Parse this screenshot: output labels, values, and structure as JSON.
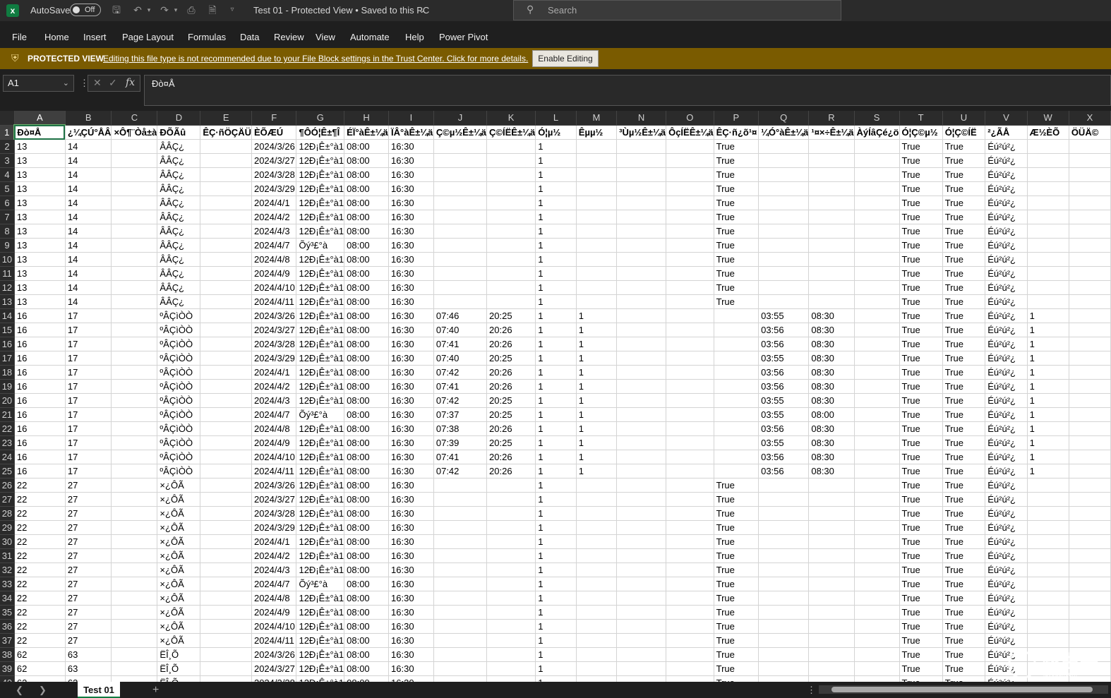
{
  "titlebar": {
    "autosave_label": "AutoSave",
    "autosave_state": "Off",
    "doc_title": "Test 01  -  Protected View  •  Saved to this PC",
    "search_placeholder": "Search"
  },
  "menu": [
    "File",
    "Home",
    "Insert",
    "Page Layout",
    "Formulas",
    "Data",
    "Review",
    "View",
    "Automate",
    "Help",
    "Power Pivot"
  ],
  "protected_view": {
    "title": "PROTECTED VIEW",
    "message": "Editing this file type is not recommended due to your File Block settings in the Trust Center. Click for more details.",
    "button": "Enable Editing"
  },
  "formula_bar": {
    "name_box": "A1",
    "fx": "fx",
    "value": "Ðò¤Å"
  },
  "sheet": {
    "columns": [
      "A",
      "B",
      "C",
      "D",
      "E",
      "F",
      "G",
      "H",
      "I",
      "J",
      "K",
      "L",
      "M",
      "N",
      "O",
      "P",
      "Q",
      "R",
      "S",
      "T",
      "U",
      "V",
      "W",
      "X"
    ],
    "header_row": [
      "Ðò¤Å",
      "¿¼ÇÚ°ÅÂ",
      "×Ô¶¨Òå±à",
      "ÐÕÃû",
      "ÊÇ·ñÖÇÄÜ",
      "ÈÕÆÚ",
      "¶ÔÓ¦Ê±¶Î",
      "ÉÏ°àÊ±¼ä",
      "ÏÂ°àÊ±¼ä",
      "Ç©µ½Ê±¼ä",
      "Ç©ÍËÊ±¼ä",
      "Ó¦µ½",
      "Êµµ½",
      "³Ùµ½Ê±¼ä",
      "ÔçÍËÊ±¼ä",
      "ÊÇ·ñ¿õ¹¤",
      "¼Ó°àÊ±¼ä",
      "¹¤×÷Ê±¼ä",
      "ÀýÍâÇé¿ö",
      "Ó¦Ç©µ½",
      "Ó¦Ç©ÍË",
      "²¿ÃÅ",
      "Æ½ÈÕ",
      "ÖÜÄ©"
    ],
    "rows": [
      [
        "13",
        "14",
        "",
        "ÂÂÇ¿",
        "",
        "2024/3/26",
        "12Ð¡Ê±°à1",
        "08:00",
        "16:30",
        "",
        "",
        "1",
        "",
        "",
        "",
        "True",
        "",
        "",
        "",
        "True",
        "True",
        "Éú²ú²¿",
        "",
        ""
      ],
      [
        "13",
        "14",
        "",
        "ÂÂÇ¿",
        "",
        "2024/3/27",
        "12Ð¡Ê±°à1",
        "08:00",
        "16:30",
        "",
        "",
        "1",
        "",
        "",
        "",
        "True",
        "",
        "",
        "",
        "True",
        "True",
        "Éú²ú²¿",
        "",
        ""
      ],
      [
        "13",
        "14",
        "",
        "ÂÂÇ¿",
        "",
        "2024/3/28",
        "12Ð¡Ê±°à1",
        "08:00",
        "16:30",
        "",
        "",
        "1",
        "",
        "",
        "",
        "True",
        "",
        "",
        "",
        "True",
        "True",
        "Éú²ú²¿",
        "",
        ""
      ],
      [
        "13",
        "14",
        "",
        "ÂÂÇ¿",
        "",
        "2024/3/29",
        "12Ð¡Ê±°à1",
        "08:00",
        "16:30",
        "",
        "",
        "1",
        "",
        "",
        "",
        "True",
        "",
        "",
        "",
        "True",
        "True",
        "Éú²ú²¿",
        "",
        ""
      ],
      [
        "13",
        "14",
        "",
        "ÂÂÇ¿",
        "",
        "2024/4/1",
        "12Ð¡Ê±°à1",
        "08:00",
        "16:30",
        "",
        "",
        "1",
        "",
        "",
        "",
        "True",
        "",
        "",
        "",
        "True",
        "True",
        "Éú²ú²¿",
        "",
        ""
      ],
      [
        "13",
        "14",
        "",
        "ÂÂÇ¿",
        "",
        "2024/4/2",
        "12Ð¡Ê±°à1",
        "08:00",
        "16:30",
        "",
        "",
        "1",
        "",
        "",
        "",
        "True",
        "",
        "",
        "",
        "True",
        "True",
        "Éú²ú²¿",
        "",
        ""
      ],
      [
        "13",
        "14",
        "",
        "ÂÂÇ¿",
        "",
        "2024/4/3",
        "12Ð¡Ê±°à1",
        "08:00",
        "16:30",
        "",
        "",
        "1",
        "",
        "",
        "",
        "True",
        "",
        "",
        "",
        "True",
        "True",
        "Éú²ú²¿",
        "",
        ""
      ],
      [
        "13",
        "14",
        "",
        "ÂÂÇ¿",
        "",
        "2024/4/7",
        "Õý³£°à",
        "08:00",
        "16:30",
        "",
        "",
        "1",
        "",
        "",
        "",
        "True",
        "",
        "",
        "",
        "True",
        "True",
        "Éú²ú²¿",
        "",
        ""
      ],
      [
        "13",
        "14",
        "",
        "ÂÂÇ¿",
        "",
        "2024/4/8",
        "12Ð¡Ê±°à1",
        "08:00",
        "16:30",
        "",
        "",
        "1",
        "",
        "",
        "",
        "True",
        "",
        "",
        "",
        "True",
        "True",
        "Éú²ú²¿",
        "",
        ""
      ],
      [
        "13",
        "14",
        "",
        "ÂÂÇ¿",
        "",
        "2024/4/9",
        "12Ð¡Ê±°à1",
        "08:00",
        "16:30",
        "",
        "",
        "1",
        "",
        "",
        "",
        "True",
        "",
        "",
        "",
        "True",
        "True",
        "Éú²ú²¿",
        "",
        ""
      ],
      [
        "13",
        "14",
        "",
        "ÂÂÇ¿",
        "",
        "2024/4/10",
        "12Ð¡Ê±°à1",
        "08:00",
        "16:30",
        "",
        "",
        "1",
        "",
        "",
        "",
        "True",
        "",
        "",
        "",
        "True",
        "True",
        "Éú²ú²¿",
        "",
        ""
      ],
      [
        "13",
        "14",
        "",
        "ÂÂÇ¿",
        "",
        "2024/4/11",
        "12Ð¡Ê±°à1",
        "08:00",
        "16:30",
        "",
        "",
        "1",
        "",
        "",
        "",
        "True",
        "",
        "",
        "",
        "True",
        "True",
        "Éú²ú²¿",
        "",
        ""
      ],
      [
        "16",
        "17",
        "",
        "ºÂÇìÒÒ",
        "",
        "2024/3/26",
        "12Ð¡Ê±°à1",
        "08:00",
        "16:30",
        "07:46",
        "20:25",
        "1",
        "1",
        "",
        "",
        "",
        "03:55",
        "08:30",
        "",
        "True",
        "True",
        "Éú²ú²¿",
        "1",
        ""
      ],
      [
        "16",
        "17",
        "",
        "ºÂÇìÒÒ",
        "",
        "2024/3/27",
        "12Ð¡Ê±°à1",
        "08:00",
        "16:30",
        "07:40",
        "20:26",
        "1",
        "1",
        "",
        "",
        "",
        "03:56",
        "08:30",
        "",
        "True",
        "True",
        "Éú²ú²¿",
        "1",
        ""
      ],
      [
        "16",
        "17",
        "",
        "ºÂÇìÒÒ",
        "",
        "2024/3/28",
        "12Ð¡Ê±°à1",
        "08:00",
        "16:30",
        "07:41",
        "20:26",
        "1",
        "1",
        "",
        "",
        "",
        "03:56",
        "08:30",
        "",
        "True",
        "True",
        "Éú²ú²¿",
        "1",
        ""
      ],
      [
        "16",
        "17",
        "",
        "ºÂÇìÒÒ",
        "",
        "2024/3/29",
        "12Ð¡Ê±°à1",
        "08:00",
        "16:30",
        "07:40",
        "20:25",
        "1",
        "1",
        "",
        "",
        "",
        "03:55",
        "08:30",
        "",
        "True",
        "True",
        "Éú²ú²¿",
        "1",
        ""
      ],
      [
        "16",
        "17",
        "",
        "ºÂÇìÒÒ",
        "",
        "2024/4/1",
        "12Ð¡Ê±°à1",
        "08:00",
        "16:30",
        "07:42",
        "20:26",
        "1",
        "1",
        "",
        "",
        "",
        "03:56",
        "08:30",
        "",
        "True",
        "True",
        "Éú²ú²¿",
        "1",
        ""
      ],
      [
        "16",
        "17",
        "",
        "ºÂÇìÒÒ",
        "",
        "2024/4/2",
        "12Ð¡Ê±°à1",
        "08:00",
        "16:30",
        "07:41",
        "20:26",
        "1",
        "1",
        "",
        "",
        "",
        "03:56",
        "08:30",
        "",
        "True",
        "True",
        "Éú²ú²¿",
        "1",
        ""
      ],
      [
        "16",
        "17",
        "",
        "ºÂÇìÒÒ",
        "",
        "2024/4/3",
        "12Ð¡Ê±°à1",
        "08:00",
        "16:30",
        "07:42",
        "20:25",
        "1",
        "1",
        "",
        "",
        "",
        "03:55",
        "08:30",
        "",
        "True",
        "True",
        "Éú²ú²¿",
        "1",
        ""
      ],
      [
        "16",
        "17",
        "",
        "ºÂÇìÒÒ",
        "",
        "2024/4/7",
        "Õý³£°à",
        "08:00",
        "16:30",
        "07:37",
        "20:25",
        "1",
        "1",
        "",
        "",
        "",
        "03:55",
        "08:00",
        "",
        "True",
        "True",
        "Éú²ú²¿",
        "1",
        ""
      ],
      [
        "16",
        "17",
        "",
        "ºÂÇìÒÒ",
        "",
        "2024/4/8",
        "12Ð¡Ê±°à1",
        "08:00",
        "16:30",
        "07:38",
        "20:26",
        "1",
        "1",
        "",
        "",
        "",
        "03:56",
        "08:30",
        "",
        "True",
        "True",
        "Éú²ú²¿",
        "1",
        ""
      ],
      [
        "16",
        "17",
        "",
        "ºÂÇìÒÒ",
        "",
        "2024/4/9",
        "12Ð¡Ê±°à1",
        "08:00",
        "16:30",
        "07:39",
        "20:25",
        "1",
        "1",
        "",
        "",
        "",
        "03:55",
        "08:30",
        "",
        "True",
        "True",
        "Éú²ú²¿",
        "1",
        ""
      ],
      [
        "16",
        "17",
        "",
        "ºÂÇìÒÒ",
        "",
        "2024/4/10",
        "12Ð¡Ê±°à1",
        "08:00",
        "16:30",
        "07:41",
        "20:26",
        "1",
        "1",
        "",
        "",
        "",
        "03:56",
        "08:30",
        "",
        "True",
        "True",
        "Éú²ú²¿",
        "1",
        ""
      ],
      [
        "16",
        "17",
        "",
        "ºÂÇìÒÒ",
        "",
        "2024/4/11",
        "12Ð¡Ê±°à1",
        "08:00",
        "16:30",
        "07:42",
        "20:26",
        "1",
        "1",
        "",
        "",
        "",
        "03:56",
        "08:30",
        "",
        "True",
        "True",
        "Éú²ú²¿",
        "1",
        ""
      ],
      [
        "22",
        "27",
        "",
        "×¿ÔÃ",
        "",
        "2024/3/26",
        "12Ð¡Ê±°à1",
        "08:00",
        "16:30",
        "",
        "",
        "1",
        "",
        "",
        "",
        "True",
        "",
        "",
        "",
        "True",
        "True",
        "Éú²ú²¿",
        "",
        ""
      ],
      [
        "22",
        "27",
        "",
        "×¿ÔÃ",
        "",
        "2024/3/27",
        "12Ð¡Ê±°à1",
        "08:00",
        "16:30",
        "",
        "",
        "1",
        "",
        "",
        "",
        "True",
        "",
        "",
        "",
        "True",
        "True",
        "Éú²ú²¿",
        "",
        ""
      ],
      [
        "22",
        "27",
        "",
        "×¿ÔÃ",
        "",
        "2024/3/28",
        "12Ð¡Ê±°à1",
        "08:00",
        "16:30",
        "",
        "",
        "1",
        "",
        "",
        "",
        "True",
        "",
        "",
        "",
        "True",
        "True",
        "Éú²ú²¿",
        "",
        ""
      ],
      [
        "22",
        "27",
        "",
        "×¿ÔÃ",
        "",
        "2024/3/29",
        "12Ð¡Ê±°à1",
        "08:00",
        "16:30",
        "",
        "",
        "1",
        "",
        "",
        "",
        "True",
        "",
        "",
        "",
        "True",
        "True",
        "Éú²ú²¿",
        "",
        ""
      ],
      [
        "22",
        "27",
        "",
        "×¿ÔÃ",
        "",
        "2024/4/1",
        "12Ð¡Ê±°à1",
        "08:00",
        "16:30",
        "",
        "",
        "1",
        "",
        "",
        "",
        "True",
        "",
        "",
        "",
        "True",
        "True",
        "Éú²ú²¿",
        "",
        ""
      ],
      [
        "22",
        "27",
        "",
        "×¿ÔÃ",
        "",
        "2024/4/2",
        "12Ð¡Ê±°à1",
        "08:00",
        "16:30",
        "",
        "",
        "1",
        "",
        "",
        "",
        "True",
        "",
        "",
        "",
        "True",
        "True",
        "Éú²ú²¿",
        "",
        ""
      ],
      [
        "22",
        "27",
        "",
        "×¿ÔÃ",
        "",
        "2024/4/3",
        "12Ð¡Ê±°à1",
        "08:00",
        "16:30",
        "",
        "",
        "1",
        "",
        "",
        "",
        "True",
        "",
        "",
        "",
        "True",
        "True",
        "Éú²ú²¿",
        "",
        ""
      ],
      [
        "22",
        "27",
        "",
        "×¿ÔÃ",
        "",
        "2024/4/7",
        "Õý³£°à",
        "08:00",
        "16:30",
        "",
        "",
        "1",
        "",
        "",
        "",
        "True",
        "",
        "",
        "",
        "True",
        "True",
        "Éú²ú²¿",
        "",
        ""
      ],
      [
        "22",
        "27",
        "",
        "×¿ÔÃ",
        "",
        "2024/4/8",
        "12Ð¡Ê±°à1",
        "08:00",
        "16:30",
        "",
        "",
        "1",
        "",
        "",
        "",
        "True",
        "",
        "",
        "",
        "True",
        "True",
        "Éú²ú²¿",
        "",
        ""
      ],
      [
        "22",
        "27",
        "",
        "×¿ÔÃ",
        "",
        "2024/4/9",
        "12Ð¡Ê±°à1",
        "08:00",
        "16:30",
        "",
        "",
        "1",
        "",
        "",
        "",
        "True",
        "",
        "",
        "",
        "True",
        "True",
        "Éú²ú²¿",
        "",
        ""
      ],
      [
        "22",
        "27",
        "",
        "×¿ÔÃ",
        "",
        "2024/4/10",
        "12Ð¡Ê±°à1",
        "08:00",
        "16:30",
        "",
        "",
        "1",
        "",
        "",
        "",
        "True",
        "",
        "",
        "",
        "True",
        "True",
        "Éú²ú²¿",
        "",
        ""
      ],
      [
        "22",
        "27",
        "",
        "×¿ÔÃ",
        "",
        "2024/4/11",
        "12Ð¡Ê±°à1",
        "08:00",
        "16:30",
        "",
        "",
        "1",
        "",
        "",
        "",
        "True",
        "",
        "",
        "",
        "True",
        "True",
        "Éú²ú²¿",
        "",
        ""
      ],
      [
        "62",
        "63",
        "",
        "ËÎ¸Õ",
        "",
        "2024/3/26",
        "12Ð¡Ê±°à1",
        "08:00",
        "16:30",
        "",
        "",
        "1",
        "",
        "",
        "",
        "True",
        "",
        "",
        "",
        "True",
        "True",
        "Éú²ú²¿",
        "",
        ""
      ],
      [
        "62",
        "63",
        "",
        "ËÎ¸Õ",
        "",
        "2024/3/27",
        "12Ð¡Ê±°à1",
        "08:00",
        "16:30",
        "",
        "",
        "1",
        "",
        "",
        "",
        "True",
        "",
        "",
        "",
        "True",
        "True",
        "Éú²ú²¿",
        "",
        ""
      ],
      [
        "62",
        "63",
        "",
        "ËÎ¸Õ",
        "",
        "2024/3/28",
        "12Ð¡Ê±°à1",
        "08:00",
        "16:30",
        "",
        "",
        "1",
        "",
        "",
        "",
        "True",
        "",
        "",
        "",
        "True",
        "True",
        "Éú²ú²¿",
        "",
        ""
      ]
    ]
  },
  "bottom": {
    "sheet_tab": "Test 01",
    "add_sheet": "+"
  },
  "watermark": {
    "text": "路由器",
    "sub": "luyouqi.com"
  }
}
